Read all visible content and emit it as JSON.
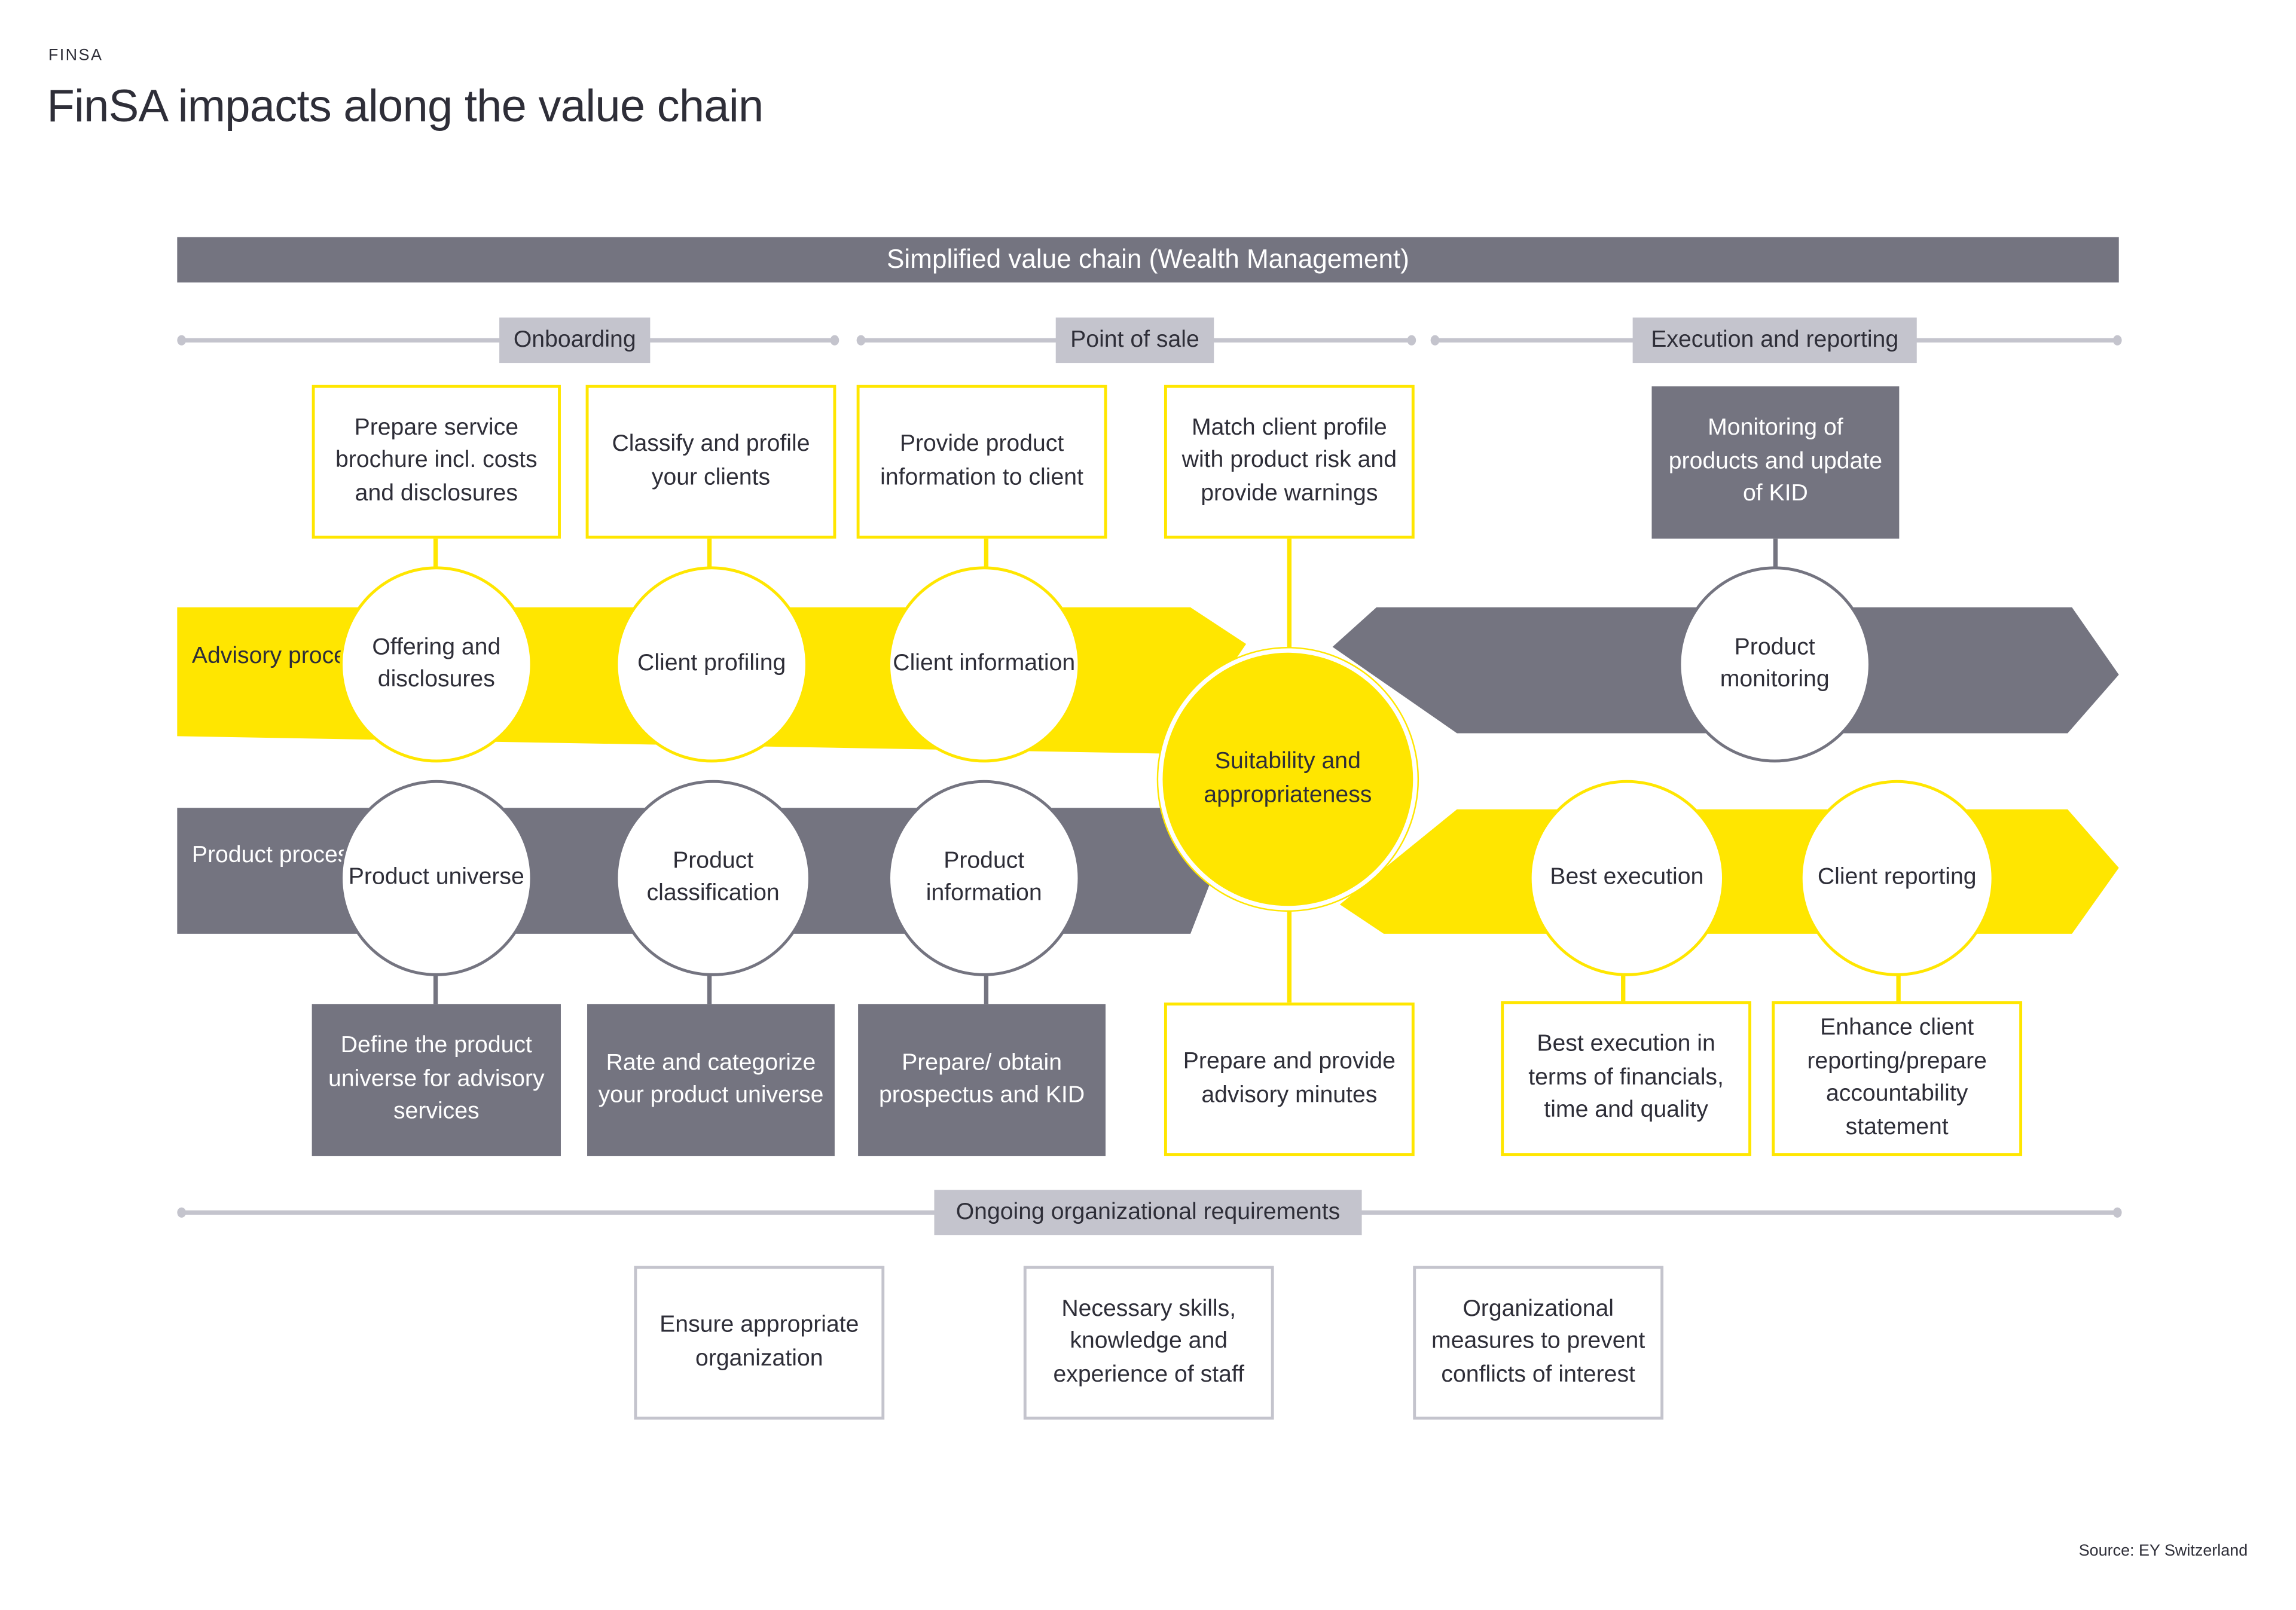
{
  "header": {
    "kicker": "FINSA",
    "title": "FinSA impacts along the value chain"
  },
  "banner": "Simplified value chain (Wealth Management)",
  "phases": {
    "onboarding": "Onboarding",
    "point_of_sale": "Point of sale",
    "execution": "Execution and reporting",
    "ongoing": "Ongoing organizational requirements"
  },
  "lanes": {
    "advisory": "Advisory process",
    "product": "Product process"
  },
  "colors": {
    "yellow": "#ffe600",
    "dark_gray": "#747480",
    "light_gray": "#c4c4cd",
    "text": "#2e2e38"
  },
  "advisory_steps": [
    {
      "circle": "Offering and disclosures",
      "box": "Prepare service brochure incl. costs and disclosures"
    },
    {
      "circle": "Client profiling",
      "box": "Classify and profile your clients"
    },
    {
      "circle": "Client information",
      "box": "Provide product information to client"
    }
  ],
  "product_steps": [
    {
      "circle": "Product universe",
      "box": "Define the product universe for advisory services"
    },
    {
      "circle": "Product classification",
      "box": "Rate and categorize your product universe"
    },
    {
      "circle": "Product information",
      "box": "Prepare/ obtain prospectus and KID"
    }
  ],
  "center": {
    "circle": "Suitability and appropriateness",
    "top_box": "Match client profile with product risk and provide warnings",
    "bottom_box": "Prepare and provide advisory minutes"
  },
  "execution_steps": {
    "monitoring": {
      "circle": "Product monitoring",
      "box": "Monitoring of products and update of KID"
    },
    "best_execution": {
      "circle": "Best execution",
      "box": "Best execution in terms of financials, time and quality"
    },
    "client_reporting": {
      "circle": "Client reporting",
      "box": "Enhance client reporting/prepare accountability statement"
    }
  },
  "ongoing_items": [
    "Ensure appropriate organization",
    "Necessary skills, knowledge and experience of staff",
    "Organizational measures to prevent conflicts of interest"
  ],
  "source": "Source: EY Switzerland"
}
